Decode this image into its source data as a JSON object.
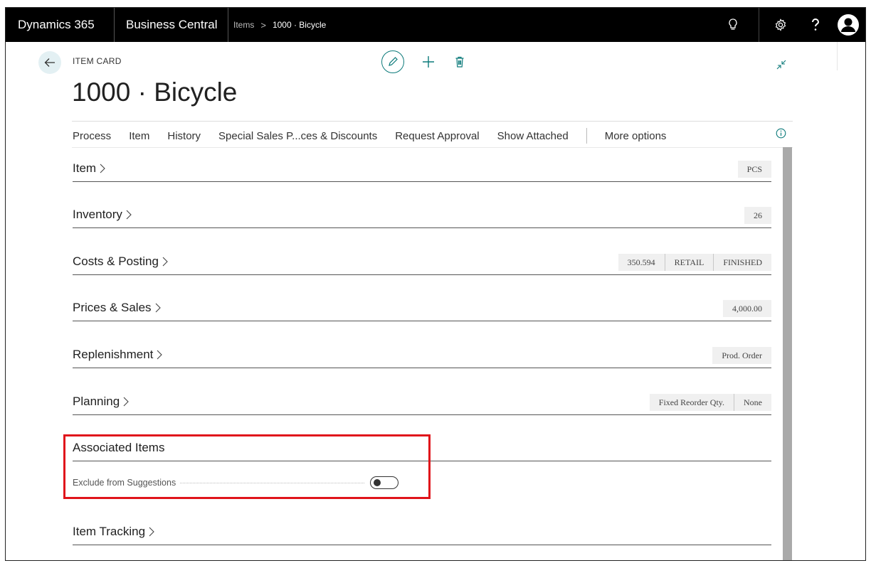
{
  "topbar": {
    "brand": "Dynamics 365",
    "app": "Business Central",
    "breadcrumb": [
      "Items",
      "1000 · Bicycle"
    ],
    "breadcrumb_sep": ">"
  },
  "header": {
    "caption": "ITEM CARD",
    "title": "1000 · Bicycle"
  },
  "nav": {
    "items": [
      "Process",
      "Item",
      "History",
      "Special Sales P...ces & Discounts",
      "Request Approval",
      "Show Attached"
    ],
    "more": "More options"
  },
  "sections": {
    "item": {
      "title": "Item",
      "chips": [
        "PCS"
      ]
    },
    "inventory": {
      "title": "Inventory",
      "chips": [
        "26"
      ]
    },
    "costs": {
      "title": "Costs & Posting",
      "chips": [
        "350.594",
        "RETAIL",
        "FINISHED"
      ]
    },
    "prices": {
      "title": "Prices & Sales",
      "chips": [
        "4,000.00"
      ]
    },
    "replenishment": {
      "title": "Replenishment",
      "chips": [
        "Prod. Order"
      ]
    },
    "planning": {
      "title": "Planning",
      "chips": [
        "Fixed Reorder Qty.",
        "None"
      ]
    },
    "associated": {
      "title": "Associated Items"
    },
    "tracking": {
      "title": "Item Tracking"
    }
  },
  "fields": {
    "exclude_label": "Exclude from Suggestions",
    "exclude_value": false
  },
  "colors": {
    "accent": "#0c7a7a",
    "highlight": "#e0141b",
    "topbar": "#000000"
  }
}
